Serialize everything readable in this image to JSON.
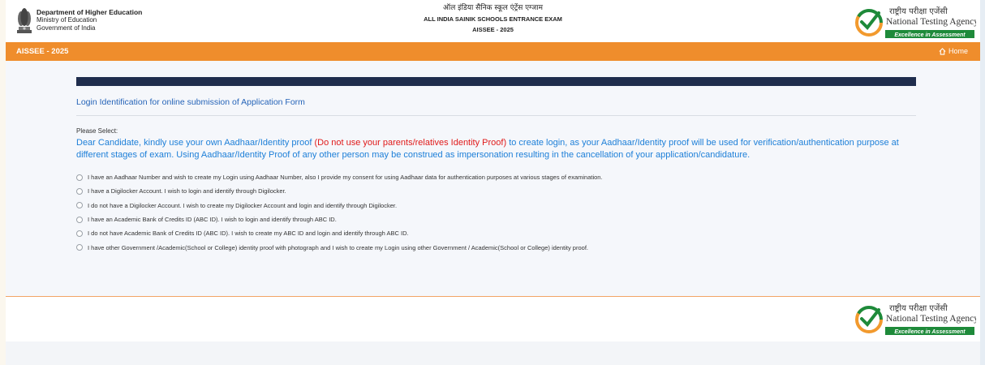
{
  "header": {
    "dept_title": "Department of Higher Education",
    "dept_line2": "Ministry of Education",
    "dept_line3": "Government of India",
    "exam_hindi": "ऑल इंडिया सैनिक स्कूल एंट्रेंस एग्जाम",
    "exam_name": "ALL INDIA SAINIK SCHOOLS ENTRANCE EXAM",
    "exam_code": "AISSEE - 2025",
    "logo": {
      "hindi": "राष्ट्रीय परीक्षा एजेंसी",
      "english": "National Testing Agency",
      "tagline": "Excellence in Assessment"
    }
  },
  "nav": {
    "title": "AISSEE - 2025",
    "home_label": "Home",
    "home_icon": "home-icon"
  },
  "main": {
    "section_title": "Login Identification for online submission of Application Form",
    "please_select": "Please Select:",
    "notice_part1": "Dear Candidate, kindly use your own Aadhaar/Identity proof ",
    "notice_warning": "(Do not use your parents/relatives Identity Proof)",
    "notice_part2": " to create login, as your Aadhaar/Identity proof will be used for verification/authentication purpose at different stages of exam. Using Aadhaar/Identity Proof of any other person may be construed as impersonation resulting in the cancellation of your application/candidature.",
    "options": [
      "I have an Aadhaar Number and wish to create my Login using Aadhaar Number, also I provide my consent for using Aadhaar data for authentication purposes at various stages of examination.",
      "I have a Digilocker Account. I wish to login and identify through Digilocker.",
      "I do not have a Digilocker Account. I wish to create my Digilocker Account and login and identify through Digilocker.",
      "I have an Academic Bank of Credits ID (ABC ID). I wish to login and identify through ABC ID.",
      "I do not have Academic Bank of Credits ID (ABC ID). I wish to create my ABC ID and login and identify through ABC ID.",
      "I have other Government /Academic(School or College) identity proof with photograph and I wish to create my Login using other Government / Academic(School or College) identity proof."
    ]
  },
  "colors": {
    "nav_orange": "#ef8d2c",
    "link_blue": "#2664b8",
    "notice_blue": "#1d7fd8",
    "warning_red": "#e01a1a",
    "strip_navy": "#1f2d4d",
    "nta_green": "#1e8a3a"
  }
}
